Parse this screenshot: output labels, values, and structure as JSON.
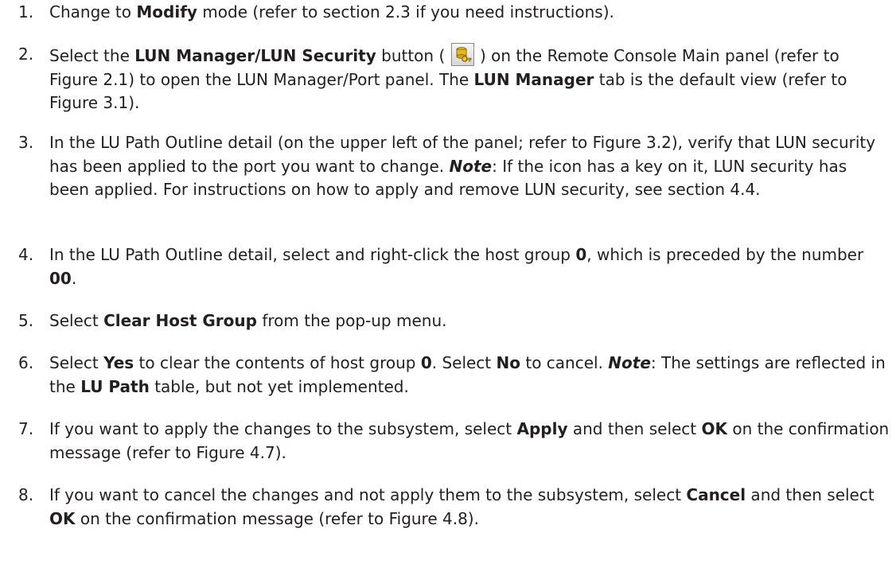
{
  "steps": [
    {
      "number": "1.",
      "parts": [
        {
          "t": "Change to "
        },
        {
          "t": "Modify",
          "b": true
        },
        {
          "t": " mode (refer to section 2.3 if you need instructions)."
        }
      ]
    },
    {
      "number": "2.",
      "parts": [
        {
          "t": "Select the "
        },
        {
          "t": "LUN Manager/LUN Security",
          "b": true
        },
        {
          "t": " button ("
        },
        {
          "icon": "lun-security-key-icon"
        },
        {
          "t": ") on the Remote Console Main panel (refer to Figure 2.1) to open the LUN Manager/Port panel. The "
        },
        {
          "t": "LUN Manager",
          "b": true
        },
        {
          "t": " tab is the default view (refer to Figure 3.1)."
        }
      ]
    },
    {
      "number": "3.",
      "parts": [
        {
          "t": "In the LU Path Outline detail (on the upper left of the panel; refer to Figure 3.2), verify that LUN security has been applied to the port you want to change. "
        },
        {
          "t": "Note",
          "note": true
        },
        {
          "t": ": If the icon has a key on it, LUN security has been applied. For instructions on how to apply and remove LUN security, see section 4.4."
        }
      ]
    },
    {
      "number": "4.",
      "parts": [
        {
          "t": "In the LU Path Outline detail, select and right-click the host group "
        },
        {
          "t": "0",
          "b": true
        },
        {
          "t": ", which is preceded by the number "
        },
        {
          "t": "00",
          "b": true
        },
        {
          "t": "."
        }
      ]
    },
    {
      "number": "5.",
      "parts": [
        {
          "t": "Select "
        },
        {
          "t": "Clear Host Group",
          "b": true
        },
        {
          "t": " from the pop-up menu."
        }
      ]
    },
    {
      "number": "6.",
      "parts": [
        {
          "t": "Select "
        },
        {
          "t": "Yes",
          "b": true
        },
        {
          "t": " to clear the contents of host group "
        },
        {
          "t": "0",
          "b": true
        },
        {
          "t": ". Select "
        },
        {
          "t": "No",
          "b": true
        },
        {
          "t": " to cancel. "
        },
        {
          "t": "Note",
          "note": true
        },
        {
          "t": ": The settings are reflected in the "
        },
        {
          "t": "LU Path",
          "b": true
        },
        {
          "t": " table, but not yet implemented."
        }
      ]
    },
    {
      "number": "7.",
      "parts": [
        {
          "t": "If you want to apply the changes to the subsystem, select "
        },
        {
          "t": "Apply",
          "b": true
        },
        {
          "t": " and then select "
        },
        {
          "t": "OK",
          "b": true
        },
        {
          "t": " on the confirmation message (refer to Figure 4.7)."
        }
      ]
    },
    {
      "number": "8.",
      "parts": [
        {
          "t": "If you want to cancel the changes and not apply them to the subsystem, select "
        },
        {
          "t": "Cancel",
          "b": true
        },
        {
          "t": " and then select "
        },
        {
          "t": "OK",
          "b": true
        },
        {
          "t": " on the confirmation message (refer to Figure 4.8)."
        }
      ]
    }
  ]
}
